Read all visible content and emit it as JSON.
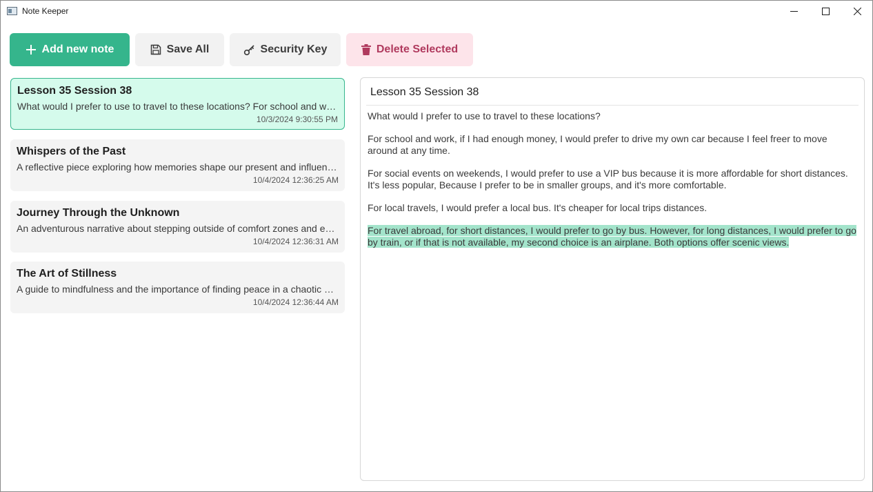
{
  "window": {
    "title": "Note Keeper"
  },
  "toolbar": {
    "add_label": "Add new note",
    "save_label": "Save All",
    "key_label": "Security Key",
    "delete_label": "Delete Selected"
  },
  "notes": [
    {
      "title": "Lesson 35 Session 38",
      "preview": "What would I prefer to use to travel to these locations?  For school and work, if I had enough money, I would prefer to drive my own car",
      "date": "10/3/2024 9:30:55 PM",
      "selected": true
    },
    {
      "title": "Whispers of the Past",
      "preview": "A reflective piece exploring how memories shape our present and influence our future",
      "date": "10/4/2024 12:36:25 AM",
      "selected": false
    },
    {
      "title": "Journey Through the Unknown",
      "preview": "An adventurous narrative about stepping outside of comfort zones and embracing the unknown",
      "date": "10/4/2024 12:36:31 AM",
      "selected": false
    },
    {
      "title": "The Art of Stillness",
      "preview": "A guide to mindfulness and the importance of finding peace in a chaotic world",
      "date": "10/4/2024 12:36:44 AM",
      "selected": false
    }
  ],
  "editor": {
    "title": "Lesson 35 Session 38",
    "paragraphs": [
      "What would I prefer to use to travel to these locations?",
      "For school and work, if I had enough money, I would prefer to drive my own car because I feel freer to move around at any time.",
      "For social events on weekends, I would prefer to use a VIP bus because it is more affordable for short distances. It's less popular, Because I prefer to be in smaller groups, and it's more comfortable.",
      "For local travels, I would prefer a local bus. It's cheaper for local trips distances.",
      "For travel abroad, for short distances, I would prefer to go by bus. However, for long distances, I would prefer to go by train, or if that is not available, my second choice is an airplane. Both options offer scenic views."
    ]
  },
  "colors": {
    "accent": "#35b58c",
    "selected_bg": "#d5fbec",
    "delete_bg": "#fde4ea",
    "delete_text": "#b03a5e",
    "highlight": "#a3e4cb"
  },
  "icons": {
    "app": "app-icon",
    "minimize": "minimize-icon",
    "maximize": "maximize-icon",
    "close": "close-icon",
    "add": "plus-icon",
    "save": "floppy-disk-icon",
    "key": "key-icon",
    "delete": "trash-icon"
  }
}
